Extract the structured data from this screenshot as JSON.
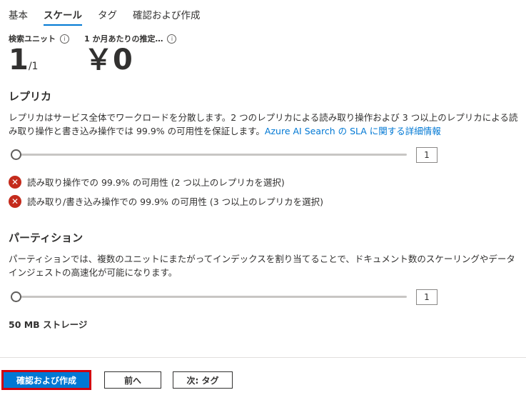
{
  "tabs": [
    {
      "label": "基本"
    },
    {
      "label": "スケール"
    },
    {
      "label": "タグ"
    },
    {
      "label": "確認および作成"
    }
  ],
  "metrics": {
    "search_units_label": "検索ユニット",
    "search_units_value": "1",
    "search_units_unit": "/1",
    "monthly_estimate_label": "1 か月あたりの推定…",
    "monthly_estimate_value": "￥0"
  },
  "replica": {
    "title": "レプリカ",
    "description": "レプリカはサービス全体でワークロードを分散します。2 つのレプリカによる読み取り操作および 3 つ以上のレプリカによる読み取り操作と書き込み操作では 99.9% の可用性を保証します。",
    "link_text": "Azure AI Search の SLA に関する詳細情報",
    "slider_value": "1",
    "errors": [
      "読み取り操作での 99.9% の可用性 (2 つ以上のレプリカを選択)",
      "読み取り/書き込み操作での 99.9% の可用性 (3 つ以上のレプリカを選択)"
    ]
  },
  "partition": {
    "title": "パーティション",
    "description": "パーティションでは、複数のユニットにまたがってインデックスを割り当てることで、ドキュメント数のスケーリングやデータ インジェストの高速化が可能になります。",
    "slider_value": "1",
    "storage": "50 MB ストレージ"
  },
  "footer": {
    "review_create": "確認および作成",
    "previous": "前へ",
    "next": "次: タグ"
  },
  "colors": {
    "accent": "#0078d4",
    "error": "#c42b1c",
    "highlight": "#d1000f"
  }
}
